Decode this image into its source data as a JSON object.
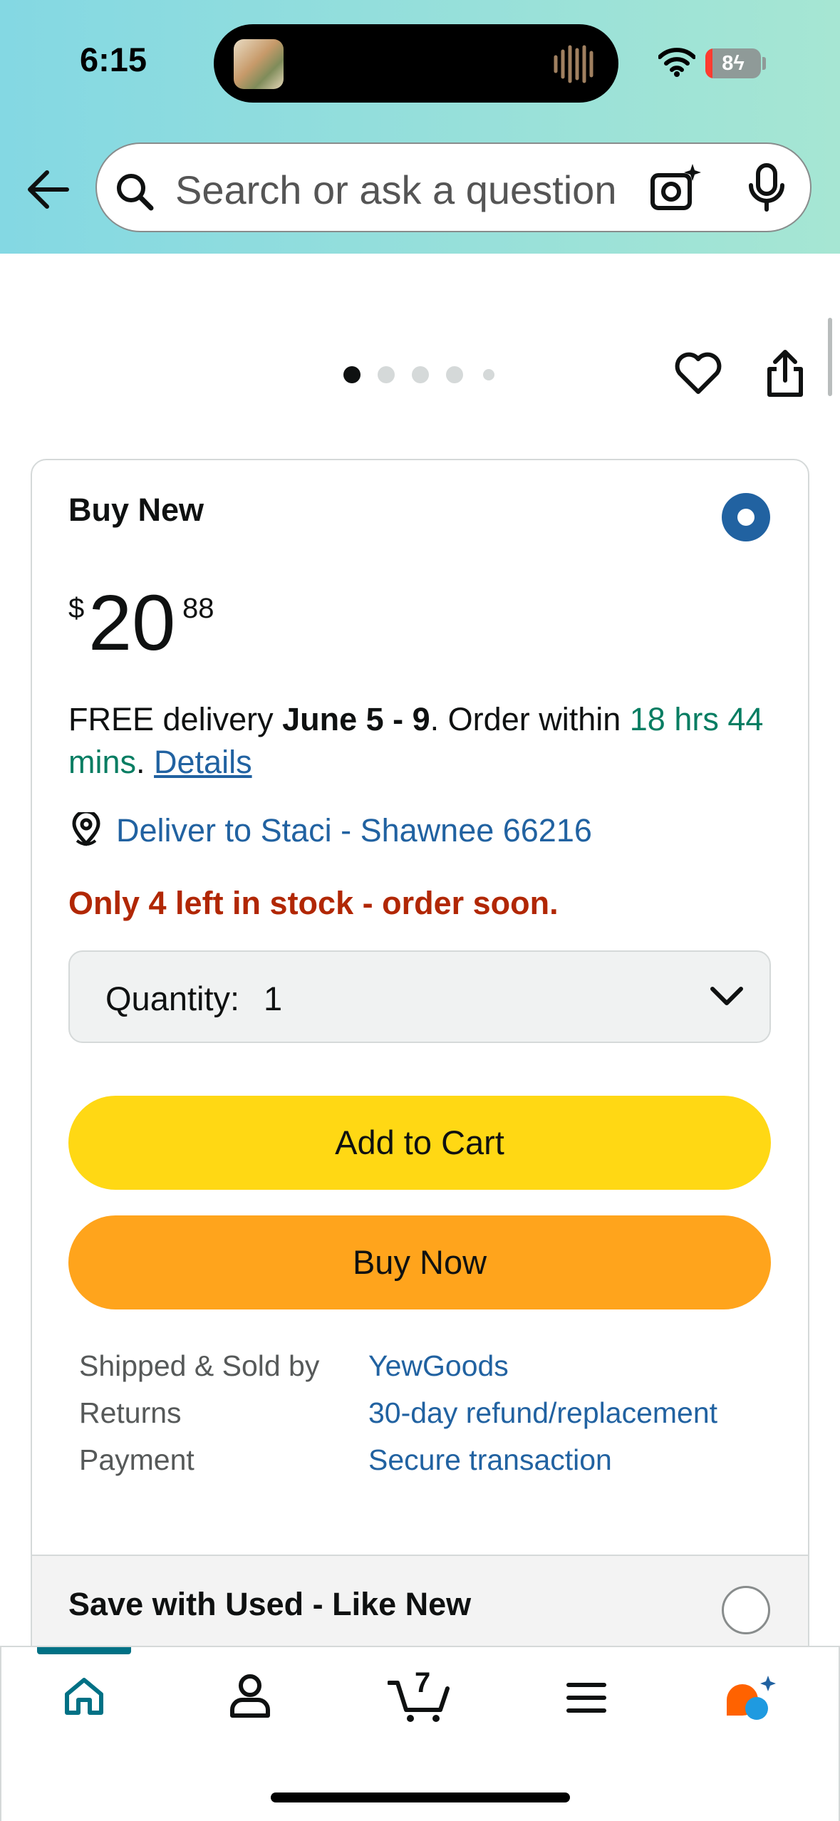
{
  "status_bar": {
    "time": "6:15",
    "battery": "8"
  },
  "header": {
    "search_placeholder": "Search or ask a question",
    "icons": [
      "back-arrow-icon",
      "search-icon",
      "camera-sparkle-icon",
      "microphone-icon"
    ]
  },
  "gallery": {
    "dot_count": 5,
    "active_dot": 0,
    "icons": [
      "heart-icon",
      "share-icon"
    ]
  },
  "buy_box": {
    "title": "Buy New",
    "price": {
      "symbol": "$",
      "whole": "20",
      "fraction": "88"
    },
    "delivery": {
      "prefix": "FREE delivery ",
      "dates": "June 5 - 9",
      "middle": ". Order within ",
      "countdown": "18 hrs 44 mins",
      "suffix": ". ",
      "details_link": "Details"
    },
    "deliver_to": "Deliver to Staci - Shawnee 66216",
    "stock": "Only 4 left in stock - order soon.",
    "quantity": {
      "label": "Quantity:",
      "value": "1"
    },
    "add_to_cart": "Add to Cart",
    "buy_now": "Buy Now",
    "info": [
      {
        "label": "Shipped & Sold by",
        "value": "YewGoods"
      },
      {
        "label": "Returns",
        "value": "30-day refund/replacement"
      },
      {
        "label": "Payment",
        "value": "Secure transaction"
      }
    ]
  },
  "used_option": {
    "title": "Save with Used - Like New"
  },
  "bottom_nav": {
    "items": [
      "home",
      "account",
      "cart",
      "menu",
      "rufus"
    ],
    "active": "home",
    "cart_count": "7"
  },
  "colors": {
    "header_gradient_start": "#84d8e3",
    "header_gradient_end": "#a6e6d3",
    "link_blue": "#2162a1",
    "stock_red": "#b12704",
    "countdown_green": "#067d62",
    "add_to_cart_yellow": "#ffd814",
    "buy_now_orange": "#ffa41c",
    "nav_active_teal": "#007185"
  }
}
